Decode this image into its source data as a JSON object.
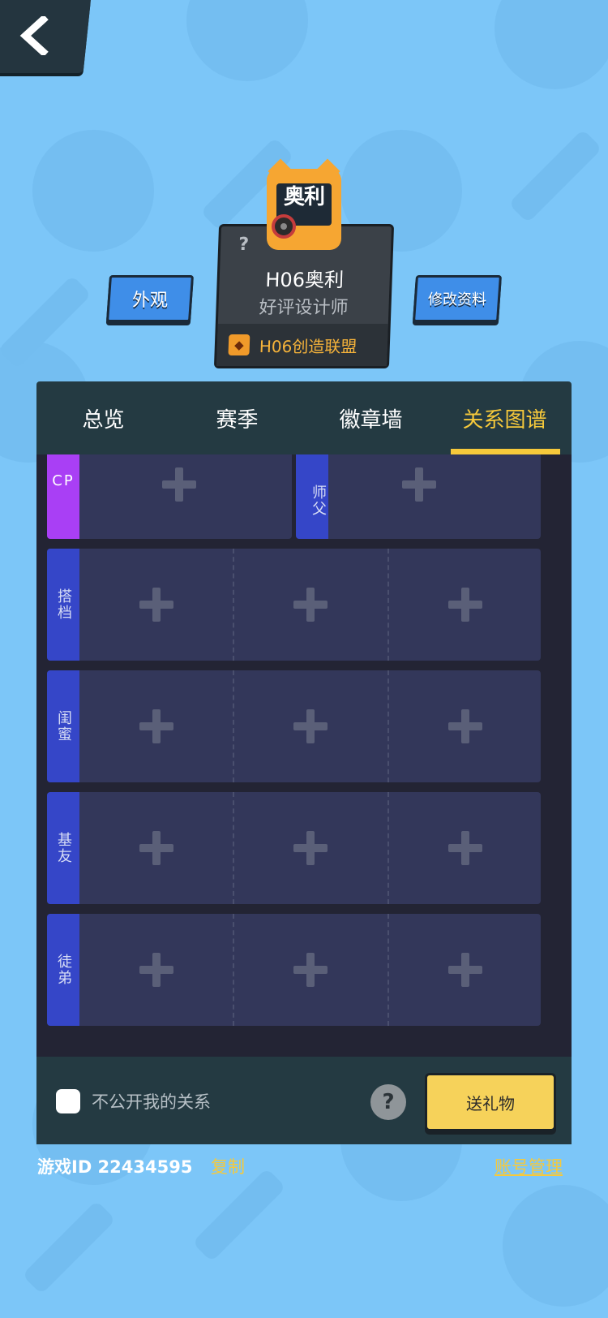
{
  "profile": {
    "avatar_label": "奥利",
    "name": "H06奥利",
    "title": "好评设计师",
    "alliance": "H06创造联盟",
    "question_mark": "?"
  },
  "buttons": {
    "appearance": "外观",
    "edit_profile": "修改资料",
    "send_gift": "送礼物"
  },
  "tabs": [
    {
      "label": "总览",
      "active": false
    },
    {
      "label": "赛季",
      "active": false
    },
    {
      "label": "徽章墙",
      "active": false
    },
    {
      "label": "关系图谱",
      "active": true
    }
  ],
  "relations": {
    "cp": "CP",
    "master": "师父",
    "rows": [
      "搭档",
      "闺蜜",
      "基友",
      "徒弟"
    ]
  },
  "footer": {
    "private_label": "不公开我的关系",
    "help": "?",
    "checkbox_checked": false
  },
  "bottom": {
    "game_id": "游戏ID 22434595",
    "copy": "复制",
    "account": "账号管理"
  },
  "colors": {
    "background": "#7cc6f8",
    "accent_yellow": "#f6c93b",
    "cp_purple": "#a93ff5",
    "relation_blue": "#3546c8"
  }
}
